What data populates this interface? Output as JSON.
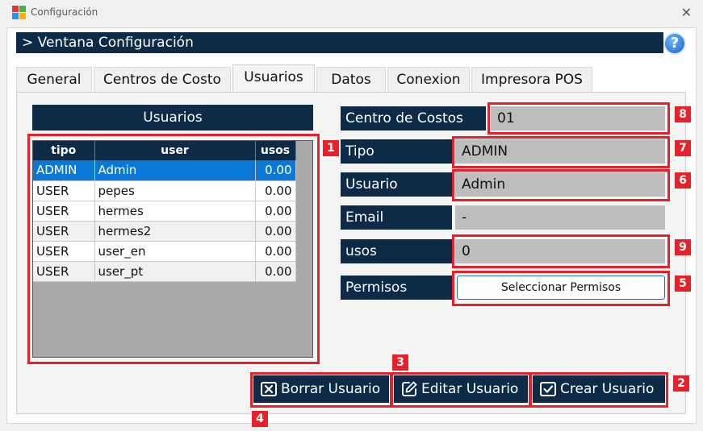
{
  "window": {
    "title": "Configuración",
    "close_glyph": "✕"
  },
  "header": {
    "title": "> Ventana Configuración",
    "help_glyph": "?"
  },
  "tabs": [
    {
      "label": "General"
    },
    {
      "label": "Centros de Costo"
    },
    {
      "label": "Usuarios",
      "active": true
    },
    {
      "label": "Datos"
    },
    {
      "label": "Conexion"
    },
    {
      "label": "Impresora POS"
    }
  ],
  "users_panel": {
    "title": "Usuarios",
    "columns": [
      "tipo",
      "user",
      "usos"
    ],
    "rows": [
      {
        "tipo": "ADMIN",
        "user": "Admin",
        "usos": "0.00",
        "selected": true
      },
      {
        "tipo": "USER",
        "user": "pepes",
        "usos": "0.00"
      },
      {
        "tipo": "USER",
        "user": "hermes",
        "usos": "0.00"
      },
      {
        "tipo": "USER",
        "user": "hermes2",
        "usos": "0.00"
      },
      {
        "tipo": "USER",
        "user": "user_en",
        "usos": "0.00"
      },
      {
        "tipo": "USER",
        "user": "user_pt",
        "usos": "0.00"
      }
    ]
  },
  "form": {
    "centro_label": "Centro de Costos",
    "centro_value": "01",
    "tipo_label": "Tipo",
    "tipo_value": "ADMIN",
    "usuario_label": "Usuario",
    "usuario_value": "Admin",
    "email_label": "Email",
    "email_value": "-",
    "usos_label": "usos",
    "usos_value": "0",
    "permisos_label": "Permisos",
    "permisos_button": "Seleccionar Permisos"
  },
  "actions": {
    "borrar": "Borrar Usuario",
    "editar": "Editar Usuario",
    "crear": "Crear Usuario"
  },
  "annotations": [
    "1",
    "2",
    "3",
    "4",
    "5",
    "6",
    "7",
    "8",
    "9"
  ],
  "colors": {
    "navy": "#0d2b47",
    "highlight_red": "#e6212a",
    "selection_blue": "#0a78d4",
    "field_gray": "#bdbdbd"
  },
  "icons": {
    "app": "app-logo-icon",
    "close": "close-icon",
    "help": "help-icon",
    "borrar": "delete-x-icon",
    "editar": "edit-pencil-icon",
    "crear": "checkmark-icon"
  }
}
